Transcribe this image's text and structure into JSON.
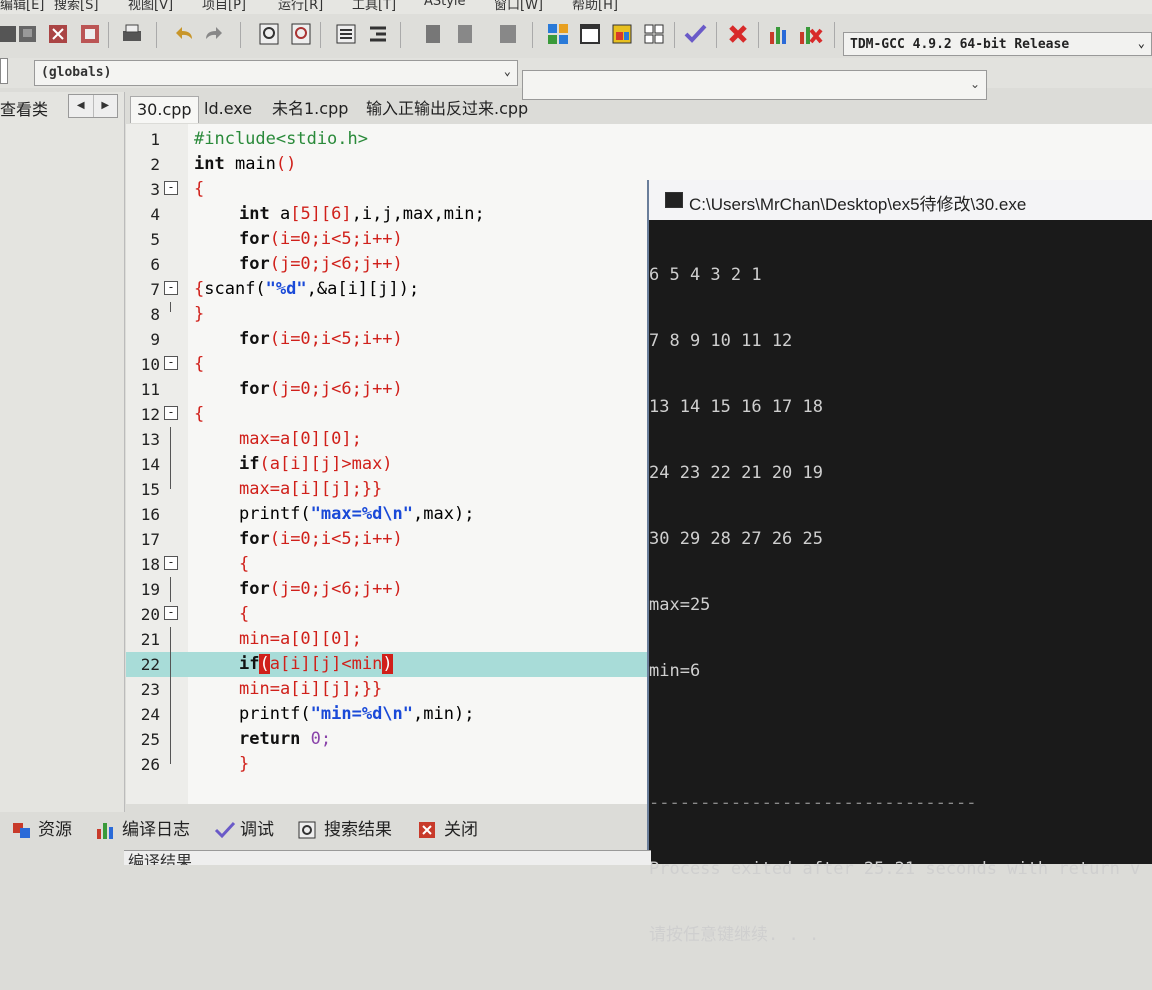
{
  "menu": {
    "items": [
      "编辑[E]",
      "搜索[S]",
      "视图[V]",
      "项目[P]",
      "运行[R]",
      "工具[T]",
      "AStyle",
      "窗口[W]",
      "帮助[H]"
    ]
  },
  "toolbar": {
    "compiler": "TDM-GCC 4.9.2 64-bit Release"
  },
  "scope": {
    "globals": "(globals)"
  },
  "left_panel": {
    "tab": "查看类"
  },
  "file_tabs": [
    "30.cpp",
    "ld.exe",
    "未名1.cpp",
    "输入正输出反过来.cpp"
  ],
  "editor": {
    "highlighted_line": 22,
    "lines": [
      {
        "n": "1"
      },
      {
        "n": "2"
      },
      {
        "n": "3"
      },
      {
        "n": "4"
      },
      {
        "n": "5"
      },
      {
        "n": "6"
      },
      {
        "n": "7"
      },
      {
        "n": "8"
      },
      {
        "n": "9"
      },
      {
        "n": "10"
      },
      {
        "n": "11"
      },
      {
        "n": "12"
      },
      {
        "n": "13"
      },
      {
        "n": "14"
      },
      {
        "n": "15"
      },
      {
        "n": "16"
      },
      {
        "n": "17"
      },
      {
        "n": "18"
      },
      {
        "n": "19"
      },
      {
        "n": "20"
      },
      {
        "n": "21"
      },
      {
        "n": "22"
      },
      {
        "n": "23"
      },
      {
        "n": "24"
      },
      {
        "n": "25"
      },
      {
        "n": "26"
      }
    ],
    "code": {
      "l1_inc": "#include<stdio.h>",
      "l2_kw": "int",
      "l2_rest": " main",
      "l2_paren": "()",
      "l3": "{",
      "l4_kw": "int",
      "l4_a": " a",
      "l4_dims": "[5][6]",
      "l4_rest": ",i,j,max,min;",
      "l5_kw": "for",
      "l5_rest": "(i=0;i<5;i++)",
      "l6_kw": "for",
      "l6_rest": "(j=0;j<6;j++)",
      "l7_open": "{",
      "l7_fn": "scanf(",
      "l7_str": "\"%d\"",
      "l7_rest": ",&a[i][j]);",
      "l8": "}",
      "l9_kw": "for",
      "l9_rest": "(i=0;i<5;i++)",
      "l10": "{",
      "l11_kw": "for",
      "l11_rest": "(j=0;j<6;j++)",
      "l12": "{",
      "l13": "max=a[0][0];",
      "l14_kw": "if",
      "l14_rest": "(a[i][j]>max)",
      "l15": "max=a[i][j];}}",
      "l16_fn": "printf(",
      "l16_str": "\"max=%d\\n\"",
      "l16_rest": ",max);",
      "l17_kw": "for",
      "l17_rest": "(i=0;i<5;i++)",
      "l18": "{",
      "l19_kw": "for",
      "l19_rest": "(j=0;j<6;j++)",
      "l20": "{",
      "l21": "min=a[0][0];",
      "l22_kw": "if",
      "l22_open": "(",
      "l22_mid": "a[i][j]<min",
      "l22_close": ")",
      "l23": "min=a[i][j];}}",
      "l24_fn": "printf(",
      "l24_str": "\"min=%d\\n\"",
      "l24_rest": ",min);",
      "l25_kw": "return",
      "l25_rest": " 0;",
      "l26": "}"
    }
  },
  "console": {
    "title": "C:\\Users\\MrChan\\Desktop\\ex5待修改\\30.exe",
    "lines": [
      "6 5 4 3 2 1",
      "7 8 9 10 11 12",
      "13 14 15 16 17 18",
      "24 23 22 21 20 19",
      "30 29 28 27 26 25",
      "max=25",
      "min=6",
      "",
      "--------------------------------",
      "Process exited after 25.21 seconds with return v",
      "请按任意键继续. . ."
    ]
  },
  "bottom_tabs": [
    "资源",
    "编译日志",
    "调试",
    "搜索结果",
    "关闭"
  ],
  "bottom_below": "编译结果"
}
